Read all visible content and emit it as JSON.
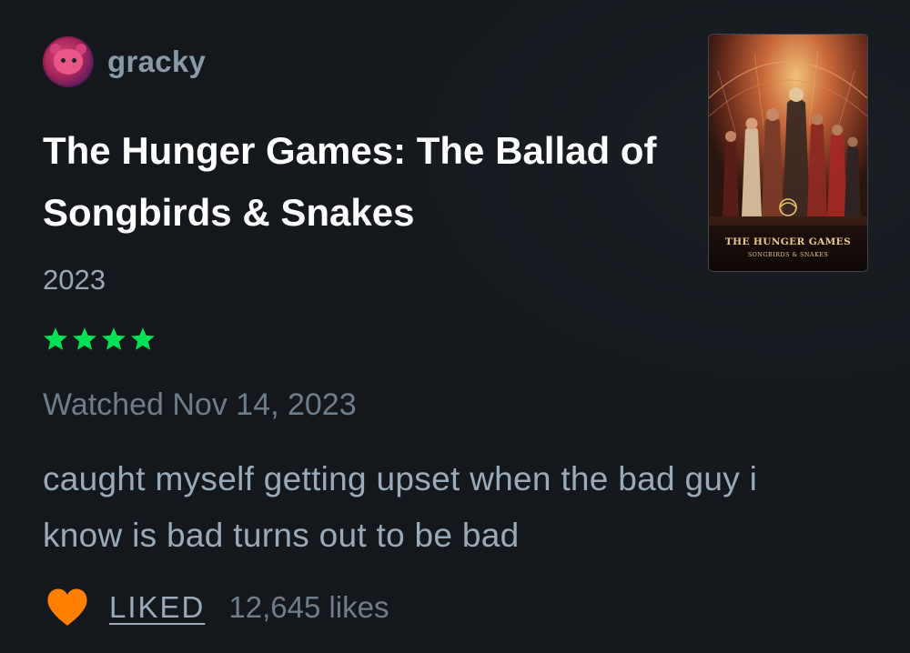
{
  "user": {
    "username": "gracky",
    "avatar_icon": "pink-character-avatar"
  },
  "film": {
    "title": "The Hunger Games: The Ballad of Songbirds & Snakes",
    "year": "2023",
    "rating_stars": 4,
    "rating_color": "#00e054",
    "poster": {
      "title_text": "THE HUNGER GAMES",
      "subtitle_text": "SONGBIRDS & SNAKES"
    }
  },
  "review": {
    "watched_text": "Watched Nov 14, 2023",
    "body": "caught myself getting upset when the bad guy i know is bad turns out to be bad"
  },
  "likes": {
    "heart_icon": "heart-icon",
    "heart_color": "#ff8000",
    "liked_label": "LIKED",
    "count_text": "12,645 likes"
  }
}
